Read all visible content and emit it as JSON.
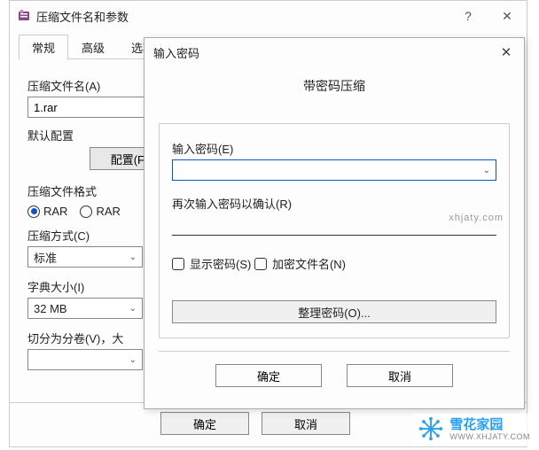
{
  "main": {
    "title": "压缩文件名和参数",
    "tabs": [
      "常规",
      "高级",
      "选项"
    ],
    "labels": {
      "archive_name": "压缩文件名(A)",
      "default_profile": "默认配置",
      "profiles_btn": "配置(F)",
      "format": "压缩文件格式",
      "method": "压缩方式(C)",
      "dict": "字典大小(I)",
      "split": "切分为分卷(V)，大"
    },
    "values": {
      "archive_name": "1.rar",
      "method": "标准",
      "dict": "32 MB",
      "split": ""
    },
    "format_options": [
      "RAR",
      "RAR"
    ],
    "buttons": {
      "ok": "确定",
      "cancel": "取消"
    }
  },
  "pwd": {
    "title": "输入密码",
    "headline": "带密码压缩",
    "labels": {
      "enter": "输入密码(E)",
      "reenter": "再次输入密码以确认(R)",
      "show": "显示密码(S)",
      "encrypt_names": "加密文件名(N)",
      "organize": "整理密码(O)...",
      "ok": "确定",
      "cancel": "取消"
    }
  },
  "watermark": {
    "cn": "雪花家园",
    "url": "WWW.XHJATY.COM",
    "mid": "xhjaty.com"
  }
}
